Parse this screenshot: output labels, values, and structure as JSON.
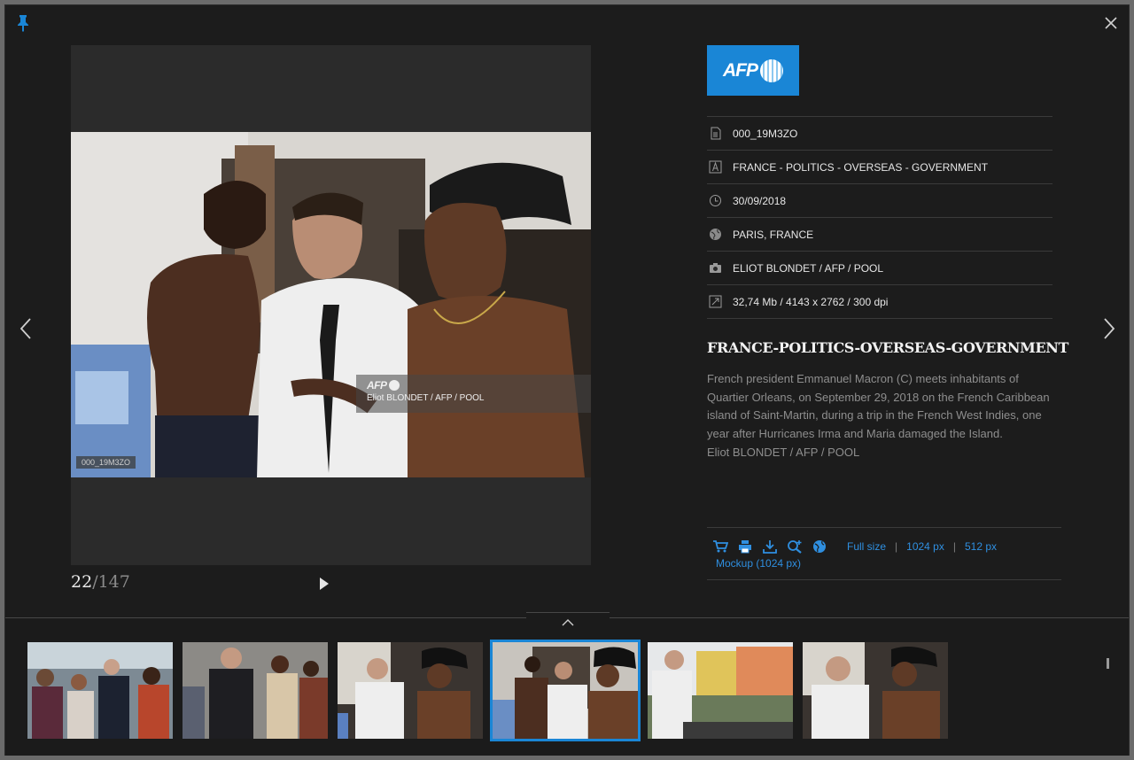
{
  "viewer": {
    "photo_id_tag": "000_19M3ZO",
    "watermark": {
      "logo_text": "AFP",
      "credit": "Eliot BLONDET / AFP / POOL"
    },
    "counter": {
      "current": "22",
      "total": "/147"
    }
  },
  "agency_logo": {
    "text": "AFP"
  },
  "meta": {
    "id": "000_19M3ZO",
    "keywords": "FRANCE - POLITICS - OVERSEAS - GOVERNMENT",
    "date": "30/09/2018",
    "location": "PARIS, FRANCE",
    "credit": "ELIOT BLONDET / AFP / POOL",
    "file_info": "32,74 Mb / 4143 x 2762 / 300 dpi"
  },
  "headline": "FRANCE-POLITICS-OVERSEAS-GOVERNMENT",
  "caption": "French president Emmanuel Macron (C) meets inhabitants of Quartier Orleans, on September 29, 2018 on the French Caribbean island of Saint-Martin, during a trip in the French West Indies, one year after Hurricanes Irma and Maria damaged the Island.\nEliot BLONDET / AFP / POOL",
  "actions": {
    "icons": [
      "cart-icon",
      "print-icon",
      "download-icon",
      "zoom-in-icon",
      "globe-icon"
    ],
    "full_size": "Full size",
    "size_1024": "1024 px",
    "size_512": "512 px",
    "separator": "|",
    "mockup": "Mockup (1024 px)"
  },
  "thumbnails": [
    {
      "label": "crowd-greeting"
    },
    {
      "label": "handshake-crowd"
    },
    {
      "label": "macron-with-residents"
    },
    {
      "label": "macron-with-residents-current"
    },
    {
      "label": "balcony-view-buildings"
    },
    {
      "label": "macron-with-resident-closeup"
    }
  ],
  "colors": {
    "accent": "#1a86d6",
    "link": "#2f8fe0",
    "background": "#1c1c1c"
  }
}
